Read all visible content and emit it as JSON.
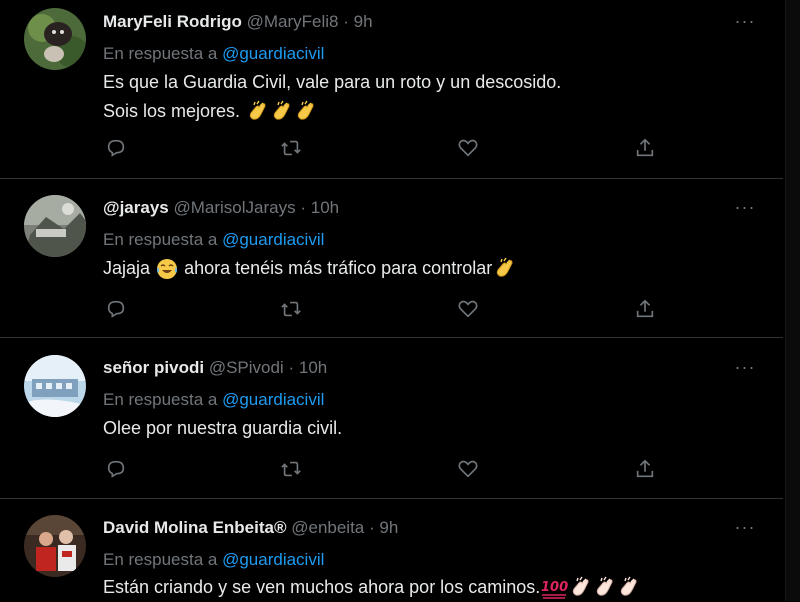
{
  "tweets": [
    {
      "name": "MaryFeli Rodrigo",
      "handle": "@MaryFeli8",
      "dot": "·",
      "time": "9h",
      "reply_prefix": "En respuesta a",
      "reply_mention": "@guardiacivil",
      "text_line1": "Es que la Guardia Civil, vale para un roto y un descosido.",
      "text_line2": "Sois los mejores.",
      "emojis": [
        "clapping-hands",
        "clapping-hands",
        "clapping-hands"
      ],
      "more_label": "···"
    },
    {
      "name": "@jarays",
      "handle": "@MarisolJarays",
      "dot": "·",
      "time": "10h",
      "reply_prefix": "En respuesta a",
      "reply_mention": "@guardiacivil",
      "text_part1": "Jajaja",
      "text_part2": "ahora tenéis más tráfico para controlar",
      "emojis": [
        "tears-of-joy",
        "clapping-hands"
      ],
      "more_label": "···"
    },
    {
      "name": "señor pivodi",
      "handle": "@SPivodi",
      "dot": "·",
      "time": "10h",
      "reply_prefix": "En respuesta a",
      "reply_mention": "@guardiacivil",
      "text_line1": "Olee por nuestra guardia civil.",
      "more_label": "···"
    },
    {
      "name": "David Molina Enbeita®",
      "handle": "@enbeita",
      "dot": "·",
      "time": "9h",
      "reply_prefix": "En respuesta a",
      "reply_mention": "@guardiacivil",
      "text_line1": "Están criando y se ven muchos ahora por los caminos.",
      "emojis": [
        "hundred-points",
        "clapping-hands",
        "clapping-hands",
        "clapping-hands"
      ],
      "more_label": "···"
    }
  ],
  "actions": [
    "reply-icon",
    "retweet-icon",
    "like-icon",
    "share-icon"
  ],
  "colors": {
    "background": "#000000",
    "text": "#e7e9ea",
    "secondary": "#71767b",
    "link": "#1d9bf0",
    "divider": "#2f3336"
  }
}
